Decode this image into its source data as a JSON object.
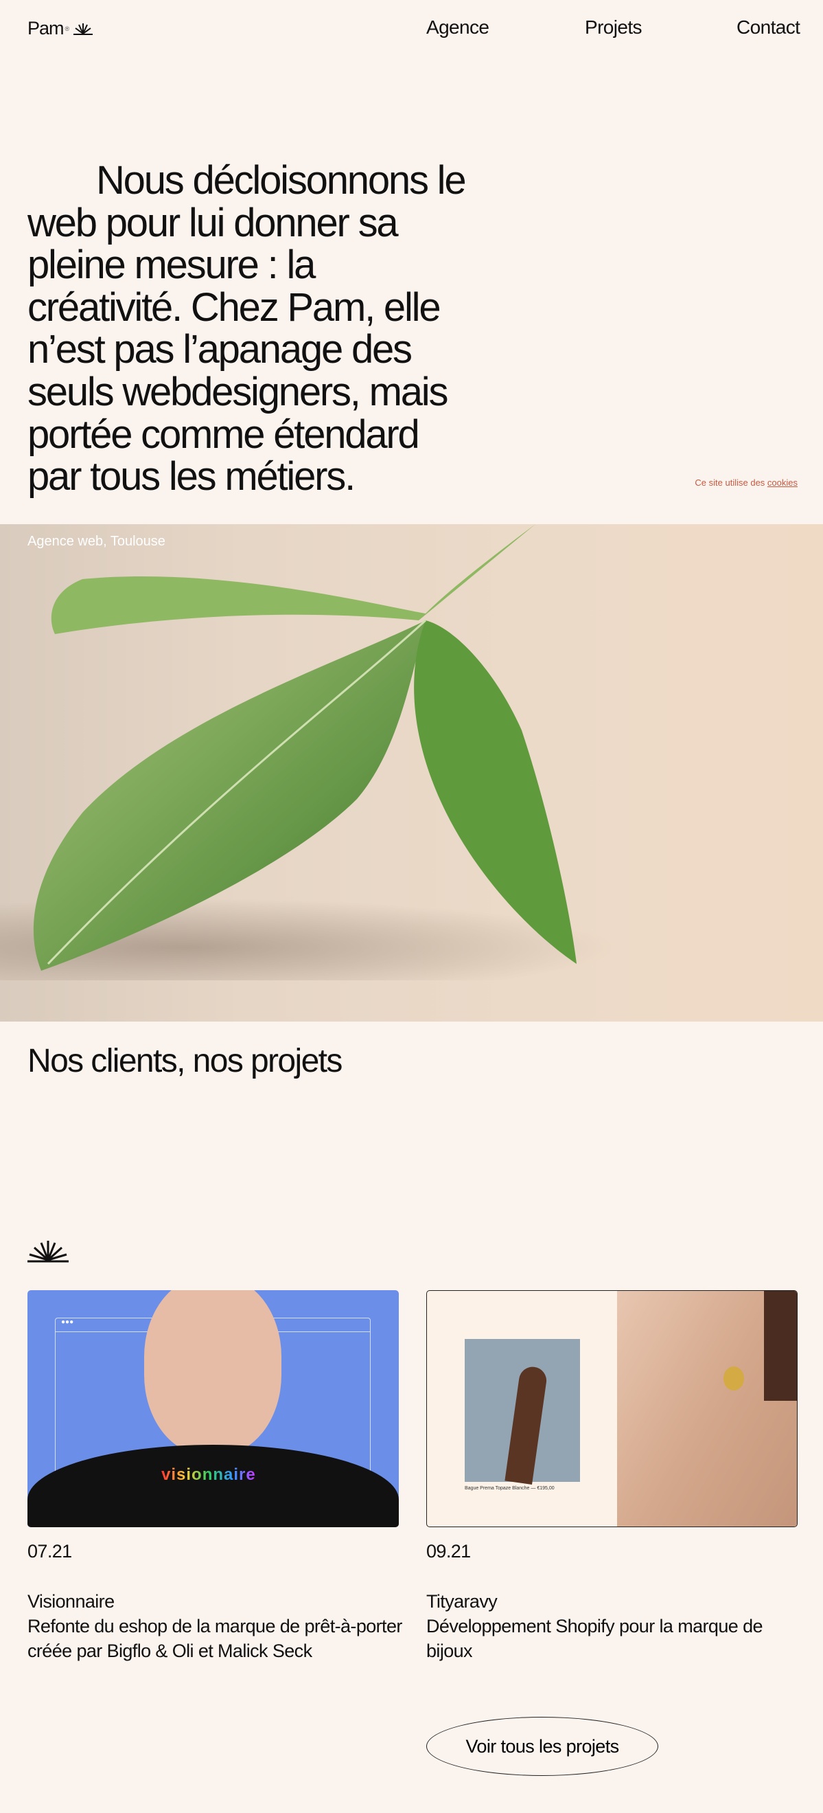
{
  "header": {
    "logo": "Pam",
    "logo_mark": "®",
    "nav": [
      "Agence",
      "Projets",
      "Contact"
    ]
  },
  "hero": {
    "text": "Nous décloisonnons le web pour lui donner sa pleine mesure : la créativité. Chez Pam, elle n’est pas l’apanage des seuls webdesigners, mais portée comme étendard par tous les métiers."
  },
  "cookies": {
    "text": "Ce site utilise des ",
    "link": "cookies"
  },
  "photo": {
    "caption": "Agence web, Toulouse"
  },
  "clients": {
    "title": "Nos clients, nos projets"
  },
  "projects": [
    {
      "date": "07.21",
      "name": "Visionnaire",
      "desc": "Refonte du eshop de la marque de prêt-à-porter créée par Bigflo & Oli et Malick Seck",
      "image_text": "visionnaire"
    },
    {
      "date": "09.21",
      "name": "Tityaravy",
      "desc": "Développement Shopify pour la marque de bijoux",
      "image_text": "Bague Prema Topaze Blanche — €195,00"
    }
  ],
  "cta": {
    "label": "Voir tous les projets"
  }
}
